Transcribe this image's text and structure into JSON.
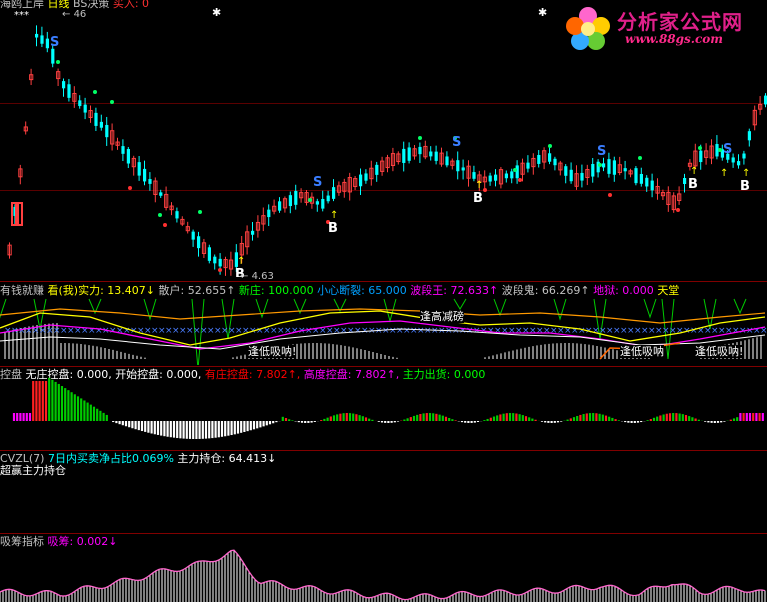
{
  "colors": {
    "up": "#ff4040",
    "down": "#00ffff",
    "bg": "#000000",
    "separator": "#800000",
    "magenta": "#ff00ff",
    "green": "#00ff00",
    "yellow": "#ffff00",
    "white": "#ffffff"
  },
  "main": {
    "title_prefix": "海鸥上岸",
    "title_period": "日线",
    "title_bs": "BS决策",
    "title_buy": "买入: 0",
    "marker_stars": "***",
    "high_price": "46",
    "low_price": "4.63",
    "signal_S": "S",
    "signal_B": "B"
  },
  "pane2": {
    "name": "有钱就赚",
    "items": [
      {
        "text": "看(我)实力: 13.407↓",
        "color": "#ffff00"
      },
      {
        "text": "散户: 52.655↑",
        "color": "#c0c0c0"
      },
      {
        "text": "新庄: 100.000",
        "color": "#00ff00"
      },
      {
        "text": "小心断裂: 65.000",
        "color": "#00a0ff"
      },
      {
        "text": "波段王: 72.633↑",
        "color": "#ff00ff"
      },
      {
        "text": "波段鬼: 66.269↑",
        "color": "#c0c0c0"
      },
      {
        "text": "地狱: 0.000",
        "color": "#ff00ff"
      },
      {
        "text": "天堂",
        "color": "#ffff00"
      }
    ],
    "annot_high": "逢高减磅",
    "annot_low1": "逢低吸呐!",
    "annot_low2": "逢低吸呐",
    "annot_low3": "逢低吸呐!"
  },
  "pane3": {
    "name": "控盘",
    "items": [
      {
        "text": "无庄控盘: 0.000,",
        "color": "#ffffff"
      },
      {
        "text": "开始控盘: 0.000,",
        "color": "#ffffff"
      },
      {
        "text": "有庄控盘: 7.802↑,",
        "color": "#ff0000"
      },
      {
        "text": "高度控盘: 7.802↑,",
        "color": "#ff00ff"
      },
      {
        "text": "主力出货: 0.000",
        "color": "#00ff00"
      }
    ]
  },
  "pane4": {
    "name": "CVZL(7)",
    "item1": "7日内买卖净占比0.069%",
    "item2": "主力持仓: 64.413↓",
    "line2": "超赢主力持仓"
  },
  "pane5": {
    "name": "吸筹指标",
    "item_label": "吸筹:",
    "item_value": "0.002↓"
  },
  "watermark": {
    "title": "分析家公式网",
    "url": "www.88gs.com"
  }
}
